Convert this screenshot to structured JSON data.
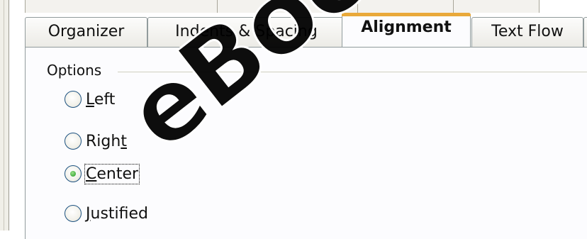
{
  "tabs": [
    {
      "label": "Organizer"
    },
    {
      "label": "Indents & Spacing"
    },
    {
      "label": "Alignment"
    },
    {
      "label": "Text Flow"
    }
  ],
  "options": {
    "title": "Options",
    "items": [
      {
        "label_pre": "",
        "accel": "L",
        "label_post": "eft",
        "checked": false
      },
      {
        "label_pre": "Righ",
        "accel": "t",
        "label_post": "",
        "checked": false
      },
      {
        "label_pre": "",
        "accel": "C",
        "label_post": "enter",
        "checked": true
      },
      {
        "label_pre": "",
        "accel": "J",
        "label_post": "ustified",
        "checked": false
      }
    ]
  },
  "watermark": {
    "text": "eBook"
  }
}
